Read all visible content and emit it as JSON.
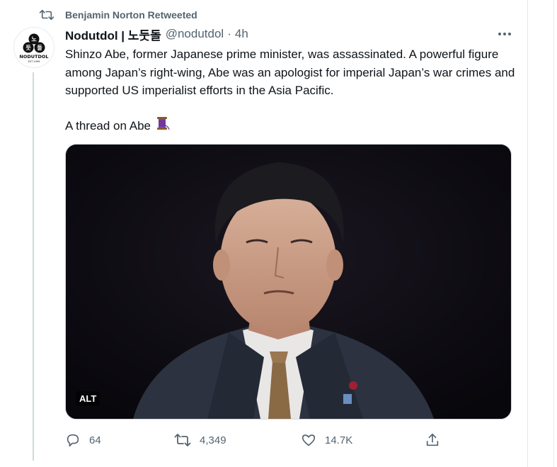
{
  "retweet_context": {
    "text": "Benjamin Norton Retweeted",
    "icon": "retweet-icon"
  },
  "author": {
    "display_name": "Nodutdol | 노둣돌",
    "handle": "@nodutdol",
    "separator": "·",
    "time": "4h",
    "avatar_logo": {
      "brand": "NODUTDOL",
      "est": "EST 1999",
      "glyphs": [
        "노",
        "둣",
        "돌"
      ]
    }
  },
  "tweet": {
    "paragraph_1": "Shinzo Abe, former Japanese prime minister, was assassinated. A powerful figure among Japan’s right-wing, Abe was an apologist for imperial Japan’s war crimes and supported US imperialist efforts in the Asia Pacific.",
    "paragraph_2": "A thread on Abe",
    "emoji_icon": "thread-spool-icon"
  },
  "media": {
    "alt_badge": "ALT"
  },
  "actions": {
    "reply": {
      "icon": "reply-icon",
      "count": "64"
    },
    "retweet": {
      "icon": "retweet-icon",
      "count": "4,349"
    },
    "like": {
      "icon": "heart-icon",
      "count": "14.7K"
    },
    "share": {
      "icon": "share-icon"
    }
  },
  "colors": {
    "secondary_text": "#536471",
    "primary_text": "#0f1419",
    "border": "#cfd9de"
  }
}
